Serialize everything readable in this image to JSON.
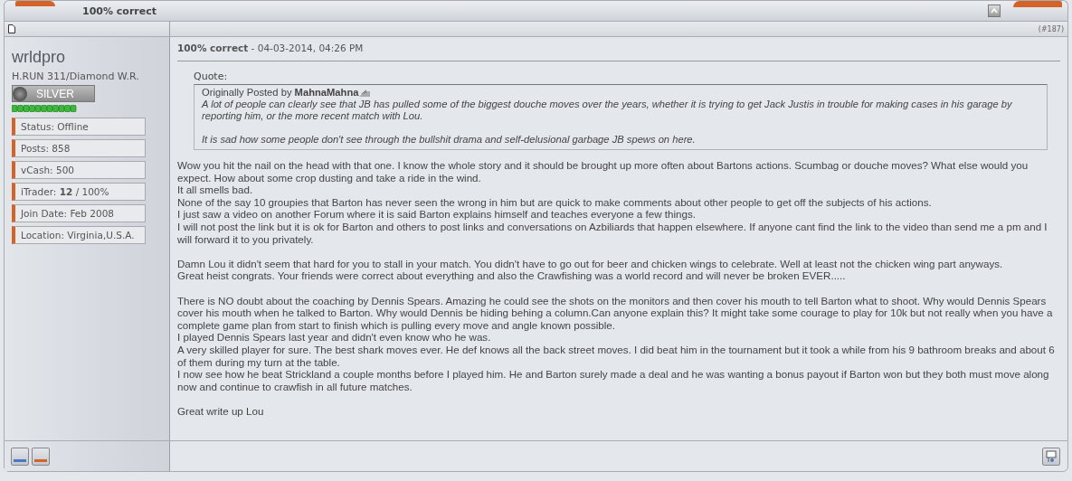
{
  "thread_title": "100% correct",
  "post_number": "(#187)",
  "user": {
    "name": "wrldpro",
    "title": "H.RUN 311/Diamond W.R.",
    "rank": "SILVER",
    "stats": [
      "Status: Offline",
      "Posts: 858",
      "vCash: 500",
      "iTrader: **12** / 100%",
      "Join Date: Feb 2008",
      "Location: Virginia,U.S.A."
    ]
  },
  "post": {
    "title": "100% correct",
    "date": "- 04-03-2014, 04:26 PM",
    "quote": {
      "label": "Quote:",
      "prefix": "Originally Posted by",
      "author": "MahnaMahna",
      "paragraphs": [
        "A lot of people can clearly see that JB has pulled some of the biggest douche moves over the years, whether it is trying to get Jack Justis in trouble for making cases in his garage by reporting him, or the more recent match with Lou.",
        "It is sad how some people don't see through the bullshit drama and self-delusional garbage JB spews on here."
      ]
    },
    "paragraphs": [
      [
        "Wow you hit the nail on the head with that one. I know the whole story and it should be brought up more often about Bartons actions. Scumbag or douche moves? What else would you expect. How about some crop dusting and take a ride in the wind.",
        "It all smells bad.",
        "None of the say 10 groupies that Barton has never seen the wrong in him but are quick to make comments about other people to get off the subjects of his actions.",
        "I just saw a video on another Forum where it is said Barton explains himself and teaches everyone a few things.",
        "I will not post the link but it is ok for Barton and others to post links and conversations on Azbiliards that happen elsewhere. If anyone cant find the link to the video than send me a pm and I will forward it to you privately."
      ],
      [
        "Damn Lou it didn't seem that hard for you to stall in your match. You didn't have to go out for beer and chicken wings to celebrate. Well at least not the chicken wing part anyways.",
        "Great heist congrats. Your friends were correct about everything and also the Crawfishing was a world record and will never be broken EVER....."
      ],
      [
        "There is NO doubt about the coaching by Dennis Spears. Amazing he could see the shots on the monitors and then cover his mouth to tell Barton what to shoot. Why would Dennis Spears cover his mouth when he talked to Barton. Why would Dennis be hiding behing a column.Can anyone explain this? It might take some courage to play for 10k but not really when you have a complete game plan from start to finish which is pulling every move and angle known possible.",
        "I played Dennis Spears last year and didn't even know who he was.",
        "A very skilled player for sure. The best shark moves ever. He def knows all the back street moves. I did beat him in the tournament but it took a while from his 9 bathroom breaks and about 6 of them during my turn at the table.",
        "I now see how he beat Strickland a couple months before I played him. He and Barton surely made a deal and he was wanting a bonus payout if Barton won but they both must move along now and continue to crawfish in all future matches."
      ],
      [
        "Great write up Lou"
      ]
    ]
  }
}
